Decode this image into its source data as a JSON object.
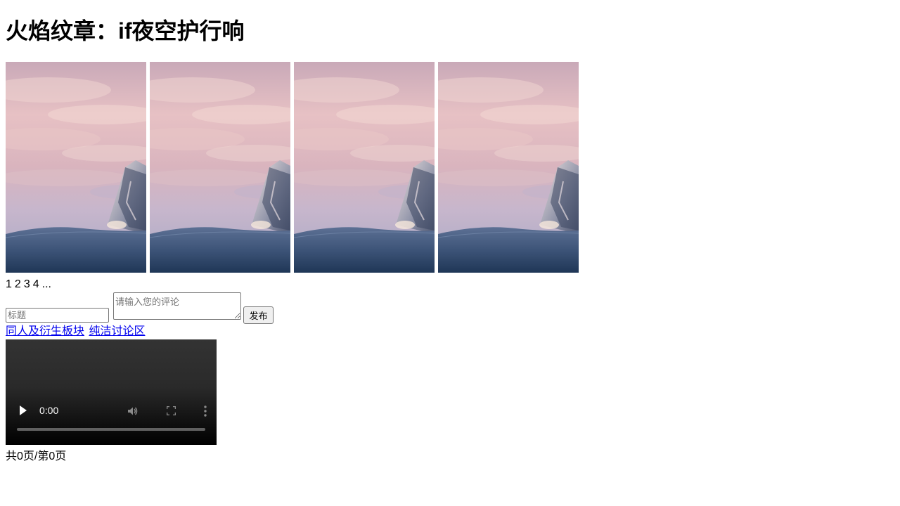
{
  "page": {
    "title": "火焰纹章：if夜空护行响"
  },
  "gallery": {
    "image_count": 4
  },
  "pager": {
    "pages": [
      "1",
      "2",
      "3",
      "4",
      "..."
    ]
  },
  "comment_form": {
    "title_placeholder": "标题",
    "comment_placeholder": "请输入您的评论",
    "publish_label": "发布"
  },
  "links": [
    {
      "label": "同人及衍生板块"
    },
    {
      "label": "纯洁讨论区"
    }
  ],
  "video": {
    "time": "0:00",
    "progress": 0
  },
  "footer": {
    "page_count": "共0页/第0页"
  }
}
